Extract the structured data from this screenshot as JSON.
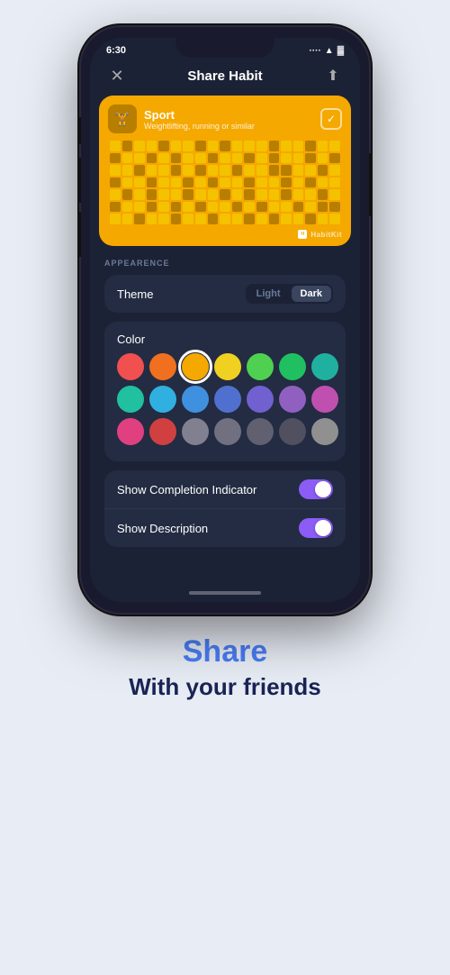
{
  "statusBar": {
    "time": "6:30",
    "signal": "····",
    "wifi": "wifi",
    "battery": "battery"
  },
  "header": {
    "title": "Share Habit",
    "closeLabel": "×",
    "shareLabel": "↑"
  },
  "habitCard": {
    "iconEmoji": "🏋",
    "name": "Sport",
    "description": "Weightlifting, running or similar",
    "brandName": "HabitKit"
  },
  "appearance": {
    "sectionLabel": "APPEARENCE",
    "themeLabel": "Theme",
    "themeLightLabel": "Light",
    "themeDarkLabel": "Dark",
    "activeTheme": "Dark",
    "colorLabel": "Color",
    "colors": [
      {
        "id": "c1",
        "hex": "#f05050",
        "selected": false
      },
      {
        "id": "c2",
        "hex": "#f07020",
        "selected": false
      },
      {
        "id": "c3",
        "hex": "#f5a800",
        "selected": true
      },
      {
        "id": "c4",
        "hex": "#f0d020",
        "selected": false
      },
      {
        "id": "c5",
        "hex": "#50d050",
        "selected": false
      },
      {
        "id": "c6",
        "hex": "#20c060",
        "selected": false
      },
      {
        "id": "c7",
        "hex": "#20b0a0",
        "selected": false
      },
      {
        "id": "c8",
        "hex": "#20c0a0",
        "selected": false
      },
      {
        "id": "c9",
        "hex": "#30b0e0",
        "selected": false
      },
      {
        "id": "c10",
        "hex": "#4090e0",
        "selected": false
      },
      {
        "id": "c11",
        "hex": "#5070d0",
        "selected": false
      },
      {
        "id": "c12",
        "hex": "#7060d0",
        "selected": false
      },
      {
        "id": "c13",
        "hex": "#9060c0",
        "selected": false
      },
      {
        "id": "c14",
        "hex": "#c050b0",
        "selected": false
      },
      {
        "id": "c15",
        "hex": "#e04080",
        "selected": false
      },
      {
        "id": "c16",
        "hex": "#d04040",
        "selected": false
      },
      {
        "id": "c17",
        "hex": "#808090",
        "selected": false
      },
      {
        "id": "c18",
        "hex": "#707080",
        "selected": false
      },
      {
        "id": "c19",
        "hex": "#606070",
        "selected": false
      },
      {
        "id": "c20",
        "hex": "#505060",
        "selected": false
      },
      {
        "id": "c21",
        "hex": "#909090",
        "selected": false
      }
    ],
    "showCompletionIndicatorLabel": "Show Completion Indicator",
    "showCompletionIndicatorOn": true,
    "showDescriptionLabel": "Show Description",
    "showDescriptionOn": true
  },
  "bottomText": {
    "shareTitle": "Share",
    "shareSubtitle": "With your friends"
  }
}
